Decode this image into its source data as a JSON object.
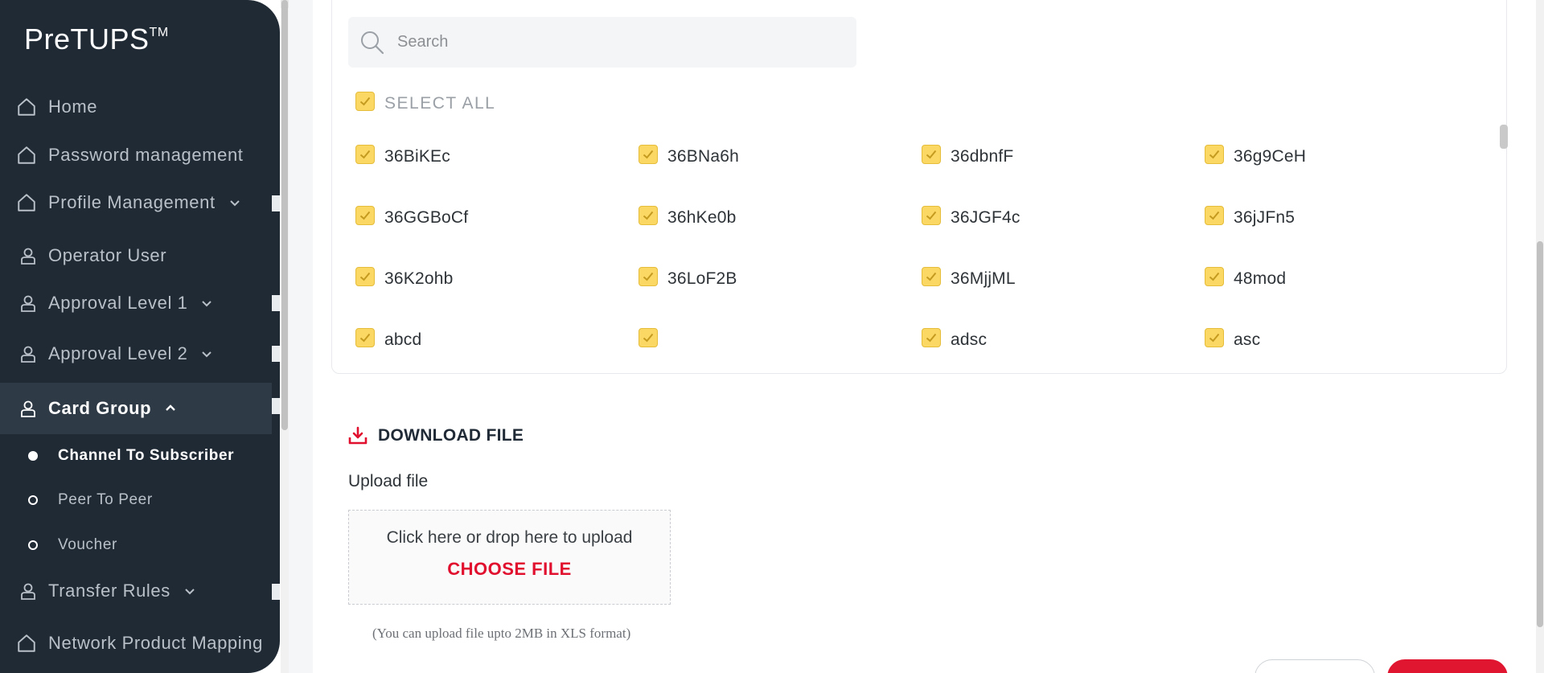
{
  "app": {
    "brand": "PreTUPS",
    "trademark": "TM"
  },
  "sidebar": {
    "items": [
      {
        "label": "Home",
        "icon": "home-icon"
      },
      {
        "label": "Password management",
        "icon": "home-icon"
      },
      {
        "label": "Profile Management",
        "icon": "home-icon"
      },
      {
        "label": "Operator User",
        "icon": "user-icon"
      },
      {
        "label": "Approval Level 1",
        "icon": "user-icon"
      },
      {
        "label": "Approval Level 2",
        "icon": "user-icon"
      },
      {
        "label": "Card Group",
        "icon": "user-icon"
      },
      {
        "label": "Transfer Rules",
        "icon": "user-icon"
      },
      {
        "label": "Network Product Mapping",
        "icon": "home-icon"
      }
    ],
    "sub_items": [
      {
        "label": "Channel To Subscriber",
        "active": true
      },
      {
        "label": "Peer To Peer",
        "active": false
      },
      {
        "label": "Voucher",
        "active": false
      }
    ]
  },
  "search": {
    "placeholder": "Search"
  },
  "select_all": {
    "label": "SELECT ALL",
    "checked": true
  },
  "options": [
    [
      "36BiKEc",
      "36BNa6h",
      "36dbnfF",
      "36g9CeH"
    ],
    [
      "36GGBoCf",
      "36hKe0b",
      "36JGF4c",
      "36jJFn5"
    ],
    [
      "36K2ohb",
      "36LoF2B",
      "36MjjML",
      "48mod"
    ],
    [
      "abcd",
      "",
      "adsc",
      "asc"
    ]
  ],
  "download": {
    "label": "DOWNLOAD FILE"
  },
  "upload": {
    "title": "Upload file",
    "prompt": "Click here or drop here to upload",
    "choose": "CHOOSE FILE",
    "hint": "(You can upload file upto 2MB in XLS format)"
  },
  "colors": {
    "sidebar": "#202a35",
    "accent_red": "#e0102e",
    "checkbox": "#fbd864"
  }
}
